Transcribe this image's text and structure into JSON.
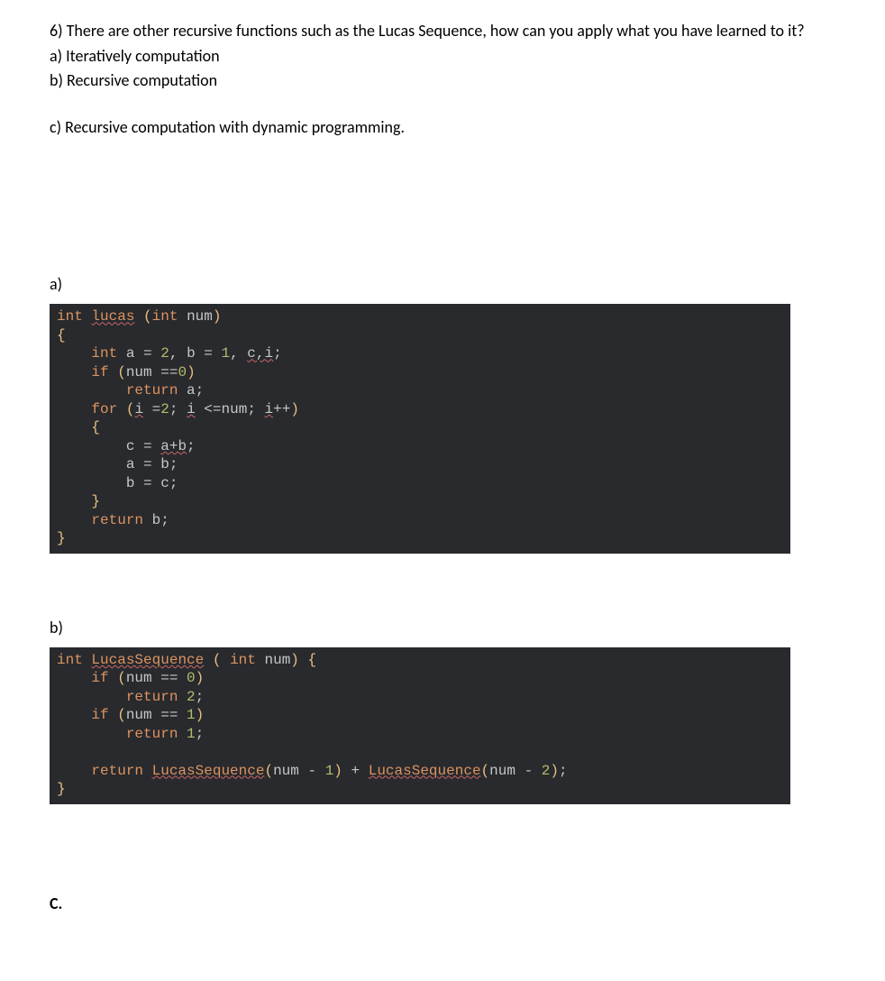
{
  "question": {
    "prompt": "6) There are other recursive functions such as the Lucas Sequence, how can you apply what you have learned to it?",
    "opt_a": "a) Iteratively computation",
    "opt_b": "b) Recursive computation",
    "opt_c": "c) Recursive computation with dynamic programming."
  },
  "labels": {
    "a": "a)",
    "b": "b)",
    "c": "C."
  },
  "code_a": {
    "l1": {
      "t_int": "int",
      "sp1": " ",
      "fn": "lucas",
      "sp2": " ",
      "lp": "(",
      "t_int2": "int",
      "sp3": " ",
      "p": "num",
      "rp": ")"
    },
    "l2": {
      "lb": "{"
    },
    "l3": {
      "ind": "    ",
      "t_int": "int",
      "sp": " ",
      "a": "a",
      "eq": " = ",
      "two": "2",
      "comma": ", ",
      "b": "b",
      "eq2": " = ",
      "one": "1",
      "comma2": ", ",
      "ci": "c,i",
      "semi": ";"
    },
    "l4": {
      "ind": "    ",
      "kw_if": "if",
      "sp": " ",
      "lp": "(",
      "num": "num",
      "sp2": " ",
      "eq": "==",
      "zero": "0",
      "rp": ")"
    },
    "l5": {
      "ind": "        ",
      "kw_ret": "return",
      "sp": " ",
      "a": "a",
      "semi": ";"
    },
    "l6": {
      "ind": "    ",
      "kw_for": "for",
      "sp": " ",
      "lp": "(",
      "i1": "i",
      "sp2": " ",
      "eq": "=",
      "two": "2",
      "semi": "; ",
      "i2": "i",
      "sp3": " ",
      "le": "<=",
      "num": "num",
      "semi2": "; ",
      "i3": "i",
      "pp": "++",
      "rp": ")"
    },
    "l7": {
      "ind": "    ",
      "lb": "{"
    },
    "l8": {
      "ind": "        ",
      "c": "c",
      "eq": " = ",
      "ab": "a+b",
      "semi": ";"
    },
    "l9": {
      "ind": "        ",
      "a": "a",
      "eq": " = ",
      "b": "b",
      "semi": ";"
    },
    "l10": {
      "ind": "        ",
      "b": "b",
      "eq": " = ",
      "c": "c",
      "semi": ";"
    },
    "l11": {
      "ind": "    ",
      "rb": "}"
    },
    "l12": {
      "ind": "    ",
      "kw_ret": "return",
      "sp": " ",
      "b": "b",
      "semi": ";"
    },
    "l13": {
      "rb": "}"
    }
  },
  "code_b": {
    "l1": {
      "t_int": "int",
      "sp": " ",
      "fn": "LucasSequence",
      "sp2": " ",
      "lp": "( ",
      "t_int2": "int",
      "sp3": " ",
      "p": "num",
      "rp": ") ",
      "lb": "{"
    },
    "l2": {
      "ind": "    ",
      "kw_if": "if",
      "sp": " ",
      "lp": "(",
      "num": "num",
      "eq": " == ",
      "zero": "0",
      "rp": ")"
    },
    "l3": {
      "ind": "        ",
      "kw_ret": "return",
      "sp": " ",
      "two": "2",
      "semi": ";"
    },
    "l4": {
      "ind": "    ",
      "kw_if": "if",
      "sp": " ",
      "lp": "(",
      "num": "num",
      "eq": " == ",
      "one": "1",
      "rp": ")"
    },
    "l5": {
      "ind": "        ",
      "kw_ret": "return",
      "sp": " ",
      "one": "1",
      "semi": ";"
    },
    "l6": {
      "blank": ""
    },
    "l7": {
      "ind": "    ",
      "kw_ret": "return",
      "sp": " ",
      "fn1": "LucasSequence",
      "lp1": "(",
      "num1": "num",
      "sp2": " - ",
      "one": "1",
      "rp1": ")",
      "plus": " + ",
      "fn2": "LucasSequence",
      "lp2": "(",
      "num2": "num",
      "sp3": " - ",
      "two": "2",
      "rp2": ")",
      "semi": ";"
    },
    "l8": {
      "rb": "}"
    }
  }
}
